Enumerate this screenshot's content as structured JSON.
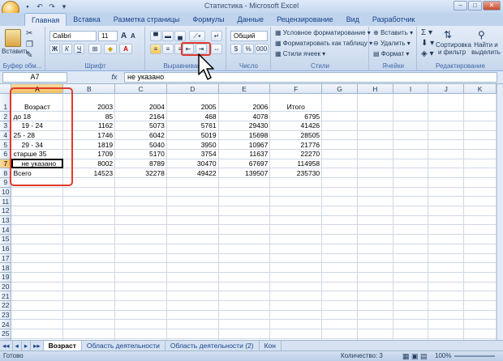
{
  "window": {
    "title": "Статистика - Microsoft Excel"
  },
  "tabs": [
    "Главная",
    "Вставка",
    "Разметка страницы",
    "Формулы",
    "Данные",
    "Рецензирование",
    "Вид",
    "Разработчик"
  ],
  "ribbon": {
    "clipboard": {
      "paste": "Вставить",
      "label": "Буфер обм..."
    },
    "font": {
      "name": "Calibri",
      "size": "11",
      "label": "Шрифт",
      "bold": "Ж",
      "italic": "К",
      "underline": "Ч",
      "grow": "A",
      "shrink": "A"
    },
    "alignment": {
      "label": "Выравнивание"
    },
    "number": {
      "format": "Общий",
      "percent": "%",
      "thousands": "000",
      "label": "Число"
    },
    "styles": {
      "conditional": "Условное форматирование",
      "table": "Форматировать как таблицу",
      "cell": "Стили ячеек",
      "label": "Стили"
    },
    "cells": {
      "insert": "Вставить",
      "delete": "Удалить",
      "format": "Формат",
      "label": "Ячейки"
    },
    "editing": {
      "sort": "Сортировка и фильтр",
      "find": "Найти и выделить",
      "label": "Редактирование"
    }
  },
  "formula_bar": {
    "name_box": "A7",
    "fx": "fx",
    "content": "не указано"
  },
  "columns": [
    "A",
    "B",
    "C",
    "D",
    "E",
    "F",
    "G",
    "H",
    "I",
    "J",
    "K"
  ],
  "rows": [
    [
      "Возраст",
      "2003",
      "2004",
      "2005",
      "2006",
      "Итого"
    ],
    [
      "до 18",
      "85",
      "2164",
      "468",
      "4078",
      "6795"
    ],
    [
      "19 - 24",
      "1162",
      "5073",
      "5761",
      "29430",
      "41426"
    ],
    [
      "25 - 28",
      "1746",
      "6042",
      "5019",
      "15698",
      "28505"
    ],
    [
      "29 - 34",
      "1819",
      "5040",
      "3950",
      "10967",
      "21776"
    ],
    [
      "старше 35",
      "1709",
      "5170",
      "3754",
      "11637",
      "22270"
    ],
    [
      "не указано",
      "8002",
      "8789",
      "30470",
      "67697",
      "114958"
    ],
    [
      "Всего",
      "14523",
      "32278",
      "49422",
      "139507",
      "235730"
    ]
  ],
  "sheet_tabs": [
    "Возраст",
    "Область деятельности",
    "Область деятельности (2)",
    "Кон"
  ],
  "status": {
    "ready": "Готово",
    "count": "Количество: 3",
    "zoom": "100%"
  }
}
